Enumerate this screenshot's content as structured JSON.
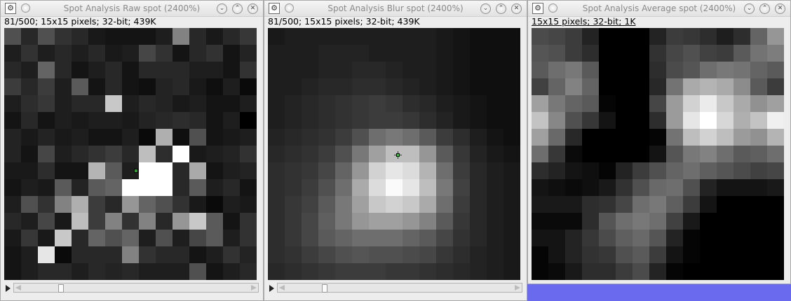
{
  "windows": [
    {
      "title": "Spot Analysis Raw spot (2400%)",
      "info": "81/500; 15x15 pixels; 32-bit; 439K",
      "icon": "imagej-icon",
      "pixels": [
        [
          80,
          40,
          80,
          50,
          40,
          25,
          20,
          20,
          20,
          30,
          130,
          40,
          25,
          40,
          55
        ],
        [
          30,
          50,
          30,
          40,
          30,
          40,
          25,
          30,
          70,
          50,
          20,
          40,
          50,
          20,
          35
        ],
        [
          40,
          30,
          100,
          40,
          20,
          30,
          40,
          20,
          40,
          40,
          40,
          30,
          30,
          20,
          50
        ],
        [
          60,
          40,
          60,
          30,
          90,
          20,
          40,
          20,
          15,
          35,
          40,
          25,
          15,
          30,
          10
        ],
        [
          30,
          45,
          55,
          30,
          40,
          40,
          200,
          30,
          40,
          35,
          25,
          30,
          20,
          20,
          30
        ],
        [
          20,
          40,
          20,
          30,
          25,
          30,
          30,
          25,
          35,
          40,
          45,
          40,
          20,
          30,
          0
        ],
        [
          35,
          25,
          35,
          25,
          30,
          20,
          20,
          30,
          10,
          175,
          15,
          80,
          20,
          25,
          30
        ],
        [
          35,
          20,
          70,
          30,
          40,
          50,
          60,
          40,
          190,
          45,
          255,
          25,
          30,
          35,
          50
        ],
        [
          25,
          25,
          45,
          20,
          20,
          180,
          90,
          30,
          255,
          255,
          40,
          170,
          20,
          30,
          35
        ],
        [
          20,
          30,
          25,
          90,
          35,
          90,
          100,
          255,
          255,
          255,
          40,
          90,
          30,
          40,
          20
        ],
        [
          30,
          80,
          50,
          130,
          175,
          60,
          40,
          150,
          100,
          80,
          50,
          25,
          10,
          30,
          25
        ],
        [
          40,
          30,
          70,
          25,
          190,
          60,
          130,
          50,
          130,
          40,
          150,
          200,
          90,
          20,
          50
        ],
        [
          25,
          55,
          25,
          200,
          40,
          100,
          80,
          100,
          30,
          80,
          30,
          70,
          90,
          30,
          50
        ],
        [
          20,
          30,
          230,
          10,
          40,
          40,
          40,
          130,
          50,
          40,
          40,
          20,
          30,
          50,
          35
        ],
        [
          20,
          30,
          40,
          40,
          30,
          40,
          35,
          40,
          30,
          30,
          30,
          80,
          20,
          30,
          40
        ]
      ]
    },
    {
      "title": "Spot Analysis Blur spot (2400%)",
      "info": "81/500; 15x15 pixels; 32-bit; 439K",
      "icon": "imagej-icon",
      "pixels": [
        [
          25,
          30,
          30,
          30,
          30,
          30,
          30,
          30,
          30,
          30,
          25,
          20,
          15,
          15,
          15
        ],
        [
          30,
          30,
          30,
          35,
          35,
          35,
          30,
          30,
          30,
          30,
          25,
          20,
          15,
          15,
          15
        ],
        [
          30,
          30,
          30,
          35,
          35,
          40,
          40,
          35,
          30,
          30,
          25,
          20,
          15,
          15,
          15
        ],
        [
          30,
          30,
          35,
          40,
          40,
          45,
          45,
          40,
          35,
          30,
          25,
          20,
          15,
          15,
          15
        ],
        [
          30,
          35,
          40,
          45,
          50,
          55,
          60,
          55,
          45,
          40,
          30,
          25,
          20,
          15,
          15
        ],
        [
          30,
          35,
          40,
          45,
          50,
          55,
          60,
          60,
          55,
          45,
          35,
          25,
          20,
          15,
          15
        ],
        [
          35,
          40,
          45,
          50,
          60,
          80,
          110,
          120,
          110,
          90,
          60,
          45,
          30,
          20,
          15
        ],
        [
          40,
          45,
          50,
          60,
          80,
          120,
          160,
          190,
          190,
          150,
          90,
          55,
          35,
          25,
          20
        ],
        [
          45,
          50,
          55,
          70,
          100,
          150,
          210,
          230,
          220,
          180,
          110,
          60,
          40,
          30,
          25
        ],
        [
          45,
          50,
          60,
          80,
          110,
          170,
          220,
          250,
          230,
          190,
          120,
          65,
          40,
          30,
          25
        ],
        [
          45,
          55,
          65,
          90,
          120,
          160,
          200,
          210,
          200,
          170,
          110,
          60,
          40,
          30,
          25
        ],
        [
          45,
          55,
          70,
          95,
          120,
          150,
          160,
          160,
          150,
          130,
          90,
          55,
          40,
          30,
          25
        ],
        [
          45,
          55,
          70,
          90,
          100,
          110,
          110,
          110,
          100,
          90,
          70,
          50,
          40,
          30,
          25
        ],
        [
          45,
          50,
          60,
          70,
          80,
          85,
          80,
          80,
          75,
          70,
          55,
          45,
          35,
          30,
          25
        ],
        [
          40,
          45,
          50,
          55,
          60,
          60,
          60,
          55,
          55,
          50,
          45,
          40,
          35,
          30,
          25
        ]
      ]
    },
    {
      "title": "Spot Analysis Average spot (2400%)",
      "info": "15x15 pixels; 32-bit; 1K",
      "icon": "imagej-icon",
      "pixels": [
        [
          75,
          70,
          60,
          35,
          0,
          0,
          0,
          35,
          60,
          55,
          45,
          30,
          45,
          100,
          150
        ],
        [
          85,
          80,
          60,
          45,
          0,
          0,
          0,
          50,
          70,
          80,
          65,
          60,
          90,
          115,
          125
        ],
        [
          90,
          110,
          120,
          90,
          0,
          0,
          0,
          45,
          75,
          85,
          110,
          120,
          115,
          100,
          90
        ],
        [
          65,
          100,
          130,
          100,
          0,
          0,
          0,
          40,
          115,
          170,
          180,
          170,
          140,
          90,
          60
        ],
        [
          160,
          120,
          100,
          90,
          5,
          0,
          0,
          70,
          155,
          210,
          235,
          200,
          170,
          145,
          160
        ],
        [
          195,
          135,
          80,
          55,
          20,
          0,
          0,
          45,
          155,
          230,
          255,
          215,
          175,
          195,
          240
        ],
        [
          160,
          105,
          40,
          0,
          0,
          0,
          0,
          5,
          115,
          190,
          210,
          190,
          155,
          145,
          180
        ],
        [
          110,
          55,
          10,
          0,
          0,
          0,
          0,
          20,
          85,
          120,
          130,
          110,
          90,
          95,
          110
        ],
        [
          45,
          35,
          20,
          15,
          5,
          35,
          60,
          80,
          100,
          110,
          95,
          85,
          75,
          65,
          70
        ],
        [
          20,
          15,
          10,
          15,
          25,
          50,
          80,
          105,
          110,
          80,
          35,
          20,
          20,
          20,
          25
        ],
        [
          25,
          25,
          25,
          45,
          50,
          70,
          110,
          120,
          95,
          60,
          20,
          0,
          0,
          0,
          0
        ],
        [
          10,
          10,
          10,
          45,
          85,
          110,
          120,
          110,
          65,
          25,
          0,
          0,
          0,
          0,
          0
        ],
        [
          20,
          20,
          35,
          55,
          75,
          95,
          105,
          85,
          35,
          5,
          0,
          0,
          0,
          0,
          0
        ],
        [
          5,
          20,
          35,
          50,
          55,
          80,
          90,
          60,
          20,
          5,
          0,
          0,
          0,
          0,
          0
        ],
        [
          5,
          10,
          25,
          45,
          45,
          60,
          75,
          35,
          5,
          0,
          0,
          0,
          0,
          0,
          0
        ]
      ]
    }
  ],
  "window_buttons": {
    "minimize": "minimize-icon",
    "maximize": "maximize-icon",
    "close": "close-icon"
  }
}
